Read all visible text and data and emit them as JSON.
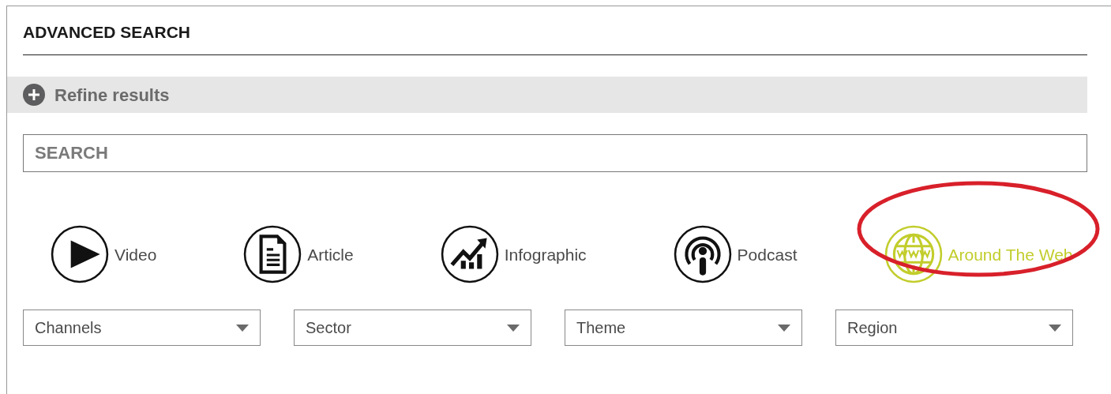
{
  "panel": {
    "title": "ADVANCED SEARCH"
  },
  "refine": {
    "label": "Refine results",
    "expanded": false
  },
  "search": {
    "placeholder": "SEARCH"
  },
  "content_types": [
    {
      "label": "Video",
      "kind": "video",
      "selected": false,
      "highlighted": false
    },
    {
      "label": "Article",
      "kind": "article",
      "selected": false,
      "highlighted": false
    },
    {
      "label": "Infographic",
      "kind": "infographic",
      "selected": false,
      "highlighted": false
    },
    {
      "label": "Podcast",
      "kind": "podcast",
      "selected": false,
      "highlighted": false
    },
    {
      "label": "Around The Web",
      "kind": "web",
      "selected": true,
      "highlighted": true
    }
  ],
  "filters": [
    {
      "label": "Channels"
    },
    {
      "label": "Sector"
    },
    {
      "label": "Theme"
    },
    {
      "label": "Region"
    }
  ]
}
